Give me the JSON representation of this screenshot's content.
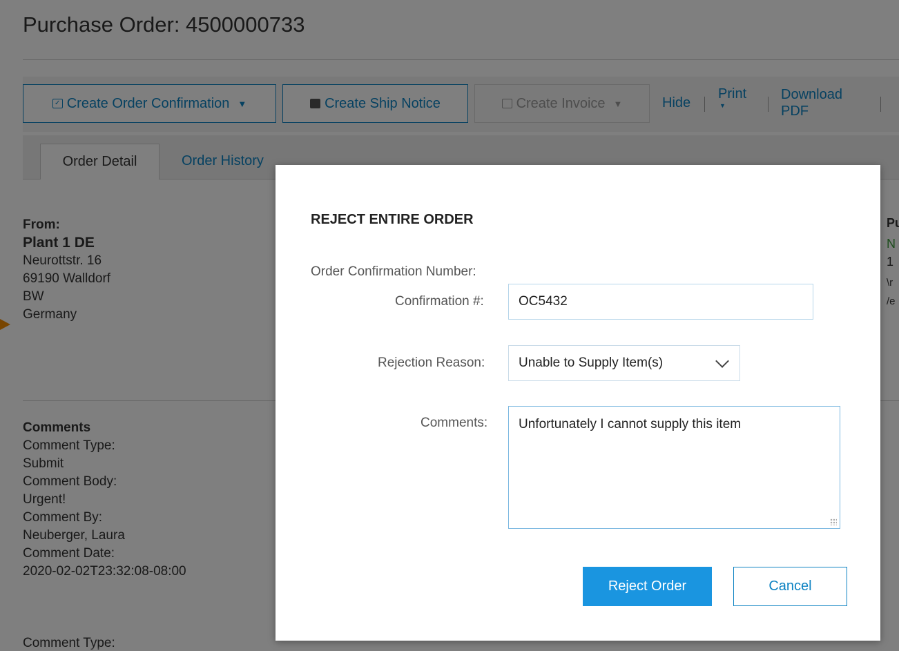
{
  "page": {
    "title": "Purchase Order: 4500000733"
  },
  "toolbar": {
    "create_confirmation": "Create Order Confirmation",
    "create_ship_notice": "Create Ship Notice",
    "create_invoice": "Create Invoice",
    "hide": "Hide",
    "print": "Print",
    "download_pdf_line1": "Download",
    "download_pdf_line2": "PDF",
    "caret": "▼",
    "separator": "|"
  },
  "tabs": {
    "order_detail": "Order Detail",
    "order_history": "Order History"
  },
  "from": {
    "label": "From:",
    "name": "Plant 1 DE",
    "street": "Neurottstr. 16",
    "city": "69190 Walldorf",
    "region": "BW",
    "country": "Germany"
  },
  "comments": {
    "heading": "Comments",
    "type_label": "Comment Type:",
    "type_value": "Submit",
    "body_label": "Comment Body:",
    "body_value": "Urgent!",
    "by_label": "Comment By:",
    "by_value": "Neuberger, Laura",
    "date_label": "Comment Date:",
    "date_value": "2020-02-02T23:32:08-08:00",
    "next_type_label": "Comment Type:"
  },
  "right_peek": {
    "line1": "Pu",
    "line2": "N",
    "line3": "1",
    "line4": "\\r",
    "line5": "/e"
  },
  "modal": {
    "title": "REJECT ENTIRE ORDER",
    "section_label": "Order Confirmation Number:",
    "confirmation_label": "Confirmation #:",
    "confirmation_value": "OC5432",
    "reason_label": "Rejection Reason:",
    "reason_value": "Unable to Supply Item(s)",
    "comments_label": "Comments:",
    "comments_value": "Unfortunately I cannot supply this item",
    "reject_button": "Reject Order",
    "cancel_button": "Cancel"
  },
  "colors": {
    "accent": "#0c82c2",
    "primary_button": "#1a95e0",
    "marker": "#f08a00"
  }
}
